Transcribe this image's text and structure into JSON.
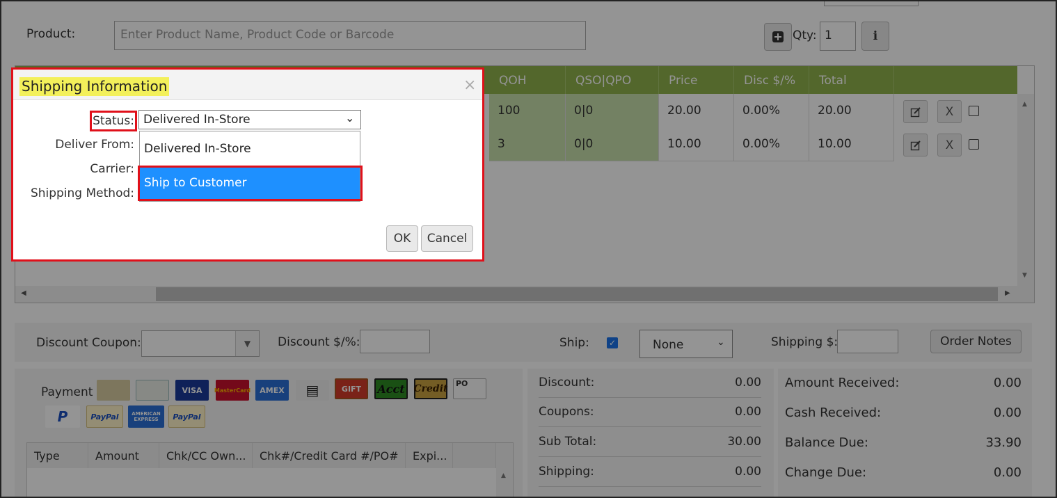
{
  "product": {
    "label": "Product:",
    "placeholder": "Enter Product Name, Product Code or Barcode",
    "qty_label": "Qty:",
    "qty_value": "1",
    "add_icon": "plus-square-icon",
    "info_icon": "info-icon"
  },
  "grid": {
    "columns": [
      "QOH",
      "QSO|QPO",
      "Price",
      "Disc $/%",
      "Total"
    ],
    "rows": [
      {
        "qoh": "100",
        "qso": "0|0",
        "price": "20.00",
        "disc": "0.00%",
        "total": "20.00",
        "remove": "X"
      },
      {
        "qoh": "3",
        "qso": "0|0",
        "price": "10.00",
        "disc": "0.00%",
        "total": "10.00",
        "remove": "X"
      }
    ]
  },
  "options": {
    "discount_coupon_label": "Discount Coupon:",
    "discount_label": "Discount $/%:",
    "ship_label": "Ship:",
    "ship_method_value": "None",
    "shipping_label": "Shipping $:",
    "order_notes_label": "Order Notes"
  },
  "payment": {
    "label": "Payment",
    "methods": [
      "Cash",
      "Check",
      "VISA",
      "MasterCard",
      "AMEX",
      "Card",
      "GIFT",
      "Acct",
      "Credit",
      "PO",
      "P",
      "PayPal",
      "AMERICAN EXPRESS",
      "PayPal"
    ],
    "columns": [
      "Type",
      "Amount",
      "Chk/CC Own...",
      "Chk#/Credit Card #/PO#",
      "Expi..."
    ]
  },
  "totals": {
    "discount_label": "Discount:",
    "discount_value": "0.00",
    "coupons_label": "Coupons:",
    "coupons_value": "0.00",
    "subtotal_label": "Sub Total:",
    "subtotal_value": "30.00",
    "shipping_label": "Shipping:",
    "shipping_value": "0.00"
  },
  "received": {
    "amount_received_label": "Amount Received:",
    "amount_received_value": "0.00",
    "cash_received_label": "Cash Received:",
    "cash_received_value": "0.00",
    "balance_due_label": "Balance Due:",
    "balance_due_value": "33.90",
    "change_due_label": "Change Due:",
    "change_due_value": "0.00"
  },
  "modal": {
    "title": "Shipping Information",
    "close": "×",
    "status_label": "Status:",
    "status_value": "Delivered In-Store",
    "deliver_from_label": "Deliver From:",
    "carrier_label": "Carrier:",
    "shipping_method_label": "Shipping Method:",
    "options": [
      "Delivered In-Store",
      "Ship to Customer"
    ],
    "ok_label": "OK",
    "cancel_label": "Cancel"
  },
  "colors": {
    "grid_header": "#8fb24d",
    "highlight_outline": "#e0101a",
    "selected_option": "#1e90ff",
    "title_highlight": "#f3f05a"
  }
}
